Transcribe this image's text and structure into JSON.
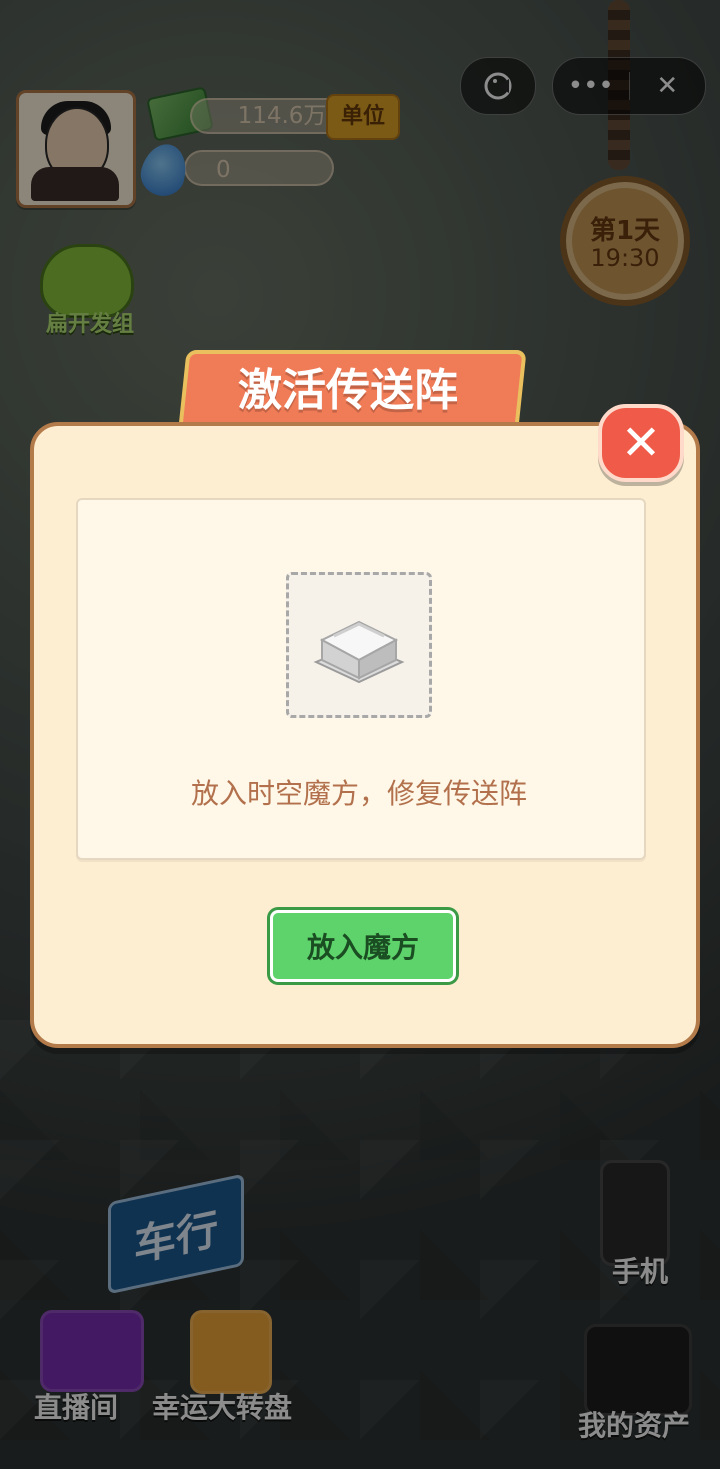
{
  "hud": {
    "money": "114.6万",
    "unit_btn": "单位",
    "water": "0",
    "frog_label": "扁开发组",
    "clock_day": "第1天",
    "clock_time": "19:30"
  },
  "capsule": {
    "game_icon": "game-icon",
    "more_icon": "more-icon",
    "close_icon": "close-icon"
  },
  "modal": {
    "title": "激活传送阵",
    "close_symbol": "✕",
    "hint": "放入时空魔方，修复传送阵",
    "button_label": "放入魔方"
  },
  "background_labels": {
    "car_sign": "车行",
    "phone": "手机",
    "live_room": "直播间",
    "lucky_wheel": "幸运大转盘",
    "my_assets": "我的资产"
  },
  "colors": {
    "accent_orange": "#f07b57",
    "modal_bg": "#fdeed2",
    "button_green": "#5ed36b",
    "close_red": "#ef5a49"
  }
}
